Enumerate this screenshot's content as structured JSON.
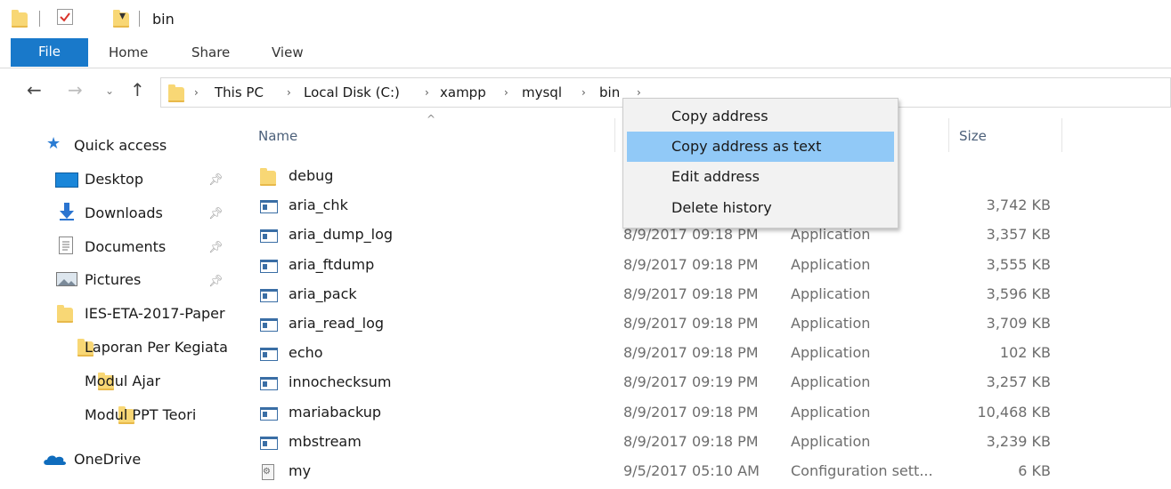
{
  "window": {
    "title": "bin"
  },
  "ribbon": {
    "tabs": [
      "File",
      "Home",
      "Share",
      "View"
    ]
  },
  "address": {
    "crumbs": [
      "This PC",
      "Local Disk (C:)",
      "xampp",
      "mysql",
      "bin"
    ]
  },
  "sidebar": {
    "quick_access": "Quick access",
    "items": [
      {
        "label": "Desktop",
        "pinned": true
      },
      {
        "label": "Downloads",
        "pinned": true
      },
      {
        "label": "Documents",
        "pinned": true
      },
      {
        "label": "Pictures",
        "pinned": true
      },
      {
        "label": "IES-ETA-2017-Paper",
        "pinned": false
      },
      {
        "label": "Laporan Per Kegiata",
        "pinned": false
      },
      {
        "label": "Modul Ajar",
        "pinned": false
      },
      {
        "label": "Modul PPT Teori",
        "pinned": false
      }
    ],
    "onedrive": "OneDrive"
  },
  "columns": {
    "name": "Name",
    "size": "Size"
  },
  "files": [
    {
      "name": "debug",
      "date": "",
      "type": "",
      "size": "",
      "icon": "folder-icon"
    },
    {
      "name": "aria_chk",
      "date": "",
      "type": "",
      "size": "3,742 KB",
      "icon": "application-icon"
    },
    {
      "name": "aria_dump_log",
      "date": "8/9/2017 09:18 PM",
      "type": "Application",
      "size": "3,357 KB",
      "icon": "application-icon"
    },
    {
      "name": "aria_ftdump",
      "date": "8/9/2017 09:18 PM",
      "type": "Application",
      "size": "3,555 KB",
      "icon": "application-icon"
    },
    {
      "name": "aria_pack",
      "date": "8/9/2017 09:18 PM",
      "type": "Application",
      "size": "3,596 KB",
      "icon": "application-icon"
    },
    {
      "name": "aria_read_log",
      "date": "8/9/2017 09:18 PM",
      "type": "Application",
      "size": "3,709 KB",
      "icon": "application-icon"
    },
    {
      "name": "echo",
      "date": "8/9/2017 09:18 PM",
      "type": "Application",
      "size": "102 KB",
      "icon": "application-icon"
    },
    {
      "name": "innochecksum",
      "date": "8/9/2017 09:19 PM",
      "type": "Application",
      "size": "3,257 KB",
      "icon": "application-icon"
    },
    {
      "name": "mariabackup",
      "date": "8/9/2017 09:18 PM",
      "type": "Application",
      "size": "10,468 KB",
      "icon": "application-icon"
    },
    {
      "name": "mbstream",
      "date": "8/9/2017 09:18 PM",
      "type": "Application",
      "size": "3,239 KB",
      "icon": "application-icon"
    },
    {
      "name": "my",
      "date": "9/5/2017 05:10 AM",
      "type": "Configuration sett...",
      "size": "6 KB",
      "icon": "config-file-icon"
    }
  ],
  "context_menu": {
    "items": [
      "Copy address",
      "Copy address as text",
      "Edit address",
      "Delete history"
    ],
    "highlighted": 1
  },
  "colors": {
    "accent": "#1979ca",
    "menu_highlight": "#91c9f7"
  }
}
